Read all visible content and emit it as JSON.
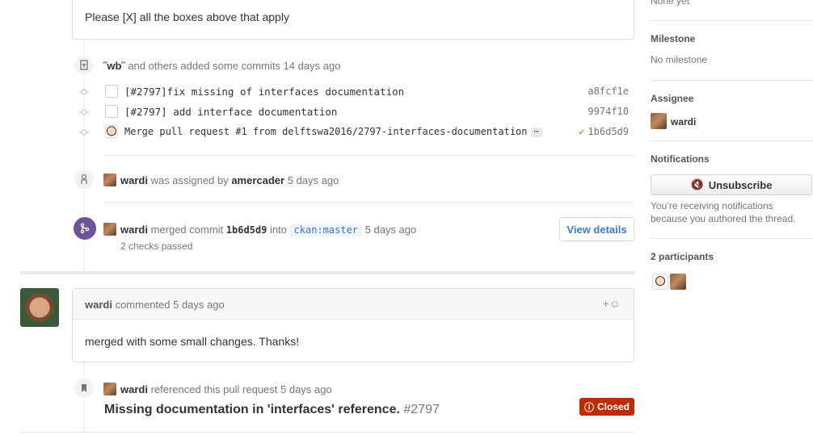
{
  "top_comment": {
    "text": "Please [X] all the boxes above that apply"
  },
  "commits_event": {
    "text_prefix": "˝wb˝",
    "text_suffix": " and others added some commits 14 days ago",
    "commits": [
      {
        "message": "[#2797]fix missing of interfaces documentation",
        "sha": "a8fcf1e",
        "avatar": "github-icon"
      },
      {
        "message": "[#2797] add interface documentation",
        "sha": "9974f10",
        "avatar": "github-icon"
      },
      {
        "message": "Merge pull request #1 from delftswa2016/2797-interfaces-documentation",
        "ellipsis": "⋯",
        "sha": "1b6d5d9",
        "status": "passed",
        "avatar": "cartoon-avatar"
      }
    ]
  },
  "assign_event": {
    "user": "wardi",
    "middle": " was assigned by ",
    "assigner": "amercader",
    "time": " 5 days ago"
  },
  "merge_event": {
    "user": "wardi",
    "middle": " merged commit ",
    "sha": "1b6d5d9",
    "into": " into ",
    "branch": "ckan:master",
    "time": " 5 days ago",
    "checks": "2 checks passed",
    "button": "View details"
  },
  "comment": {
    "user": "wardi",
    "action": " commented 5 days ago",
    "emoji_label": "+☺",
    "body": "merged with some small changes. Thanks!"
  },
  "reference_event": {
    "user": "wardi",
    "action": " referenced this pull request 5 days ago",
    "title": "Missing documentation in 'interfaces' reference.",
    "number": " #2797",
    "state": "Closed"
  },
  "sidebar": {
    "labels_value": "None yet",
    "milestone_label": "Milestone",
    "milestone_value": "No milestone",
    "assignee_label": "Assignee",
    "assignee_name": "wardi",
    "notifications_label": "Notifications",
    "unsubscribe_label": "Unsubscribe",
    "notifications_reason_1": "You’re receiving notifications",
    "notifications_reason_2": "because you authored the thread.",
    "participants_label": "2 participants"
  },
  "colors": {
    "merged": "#6e5494",
    "closed": "#bd2c00",
    "link": "#4078c0",
    "success": "#6cc644"
  }
}
